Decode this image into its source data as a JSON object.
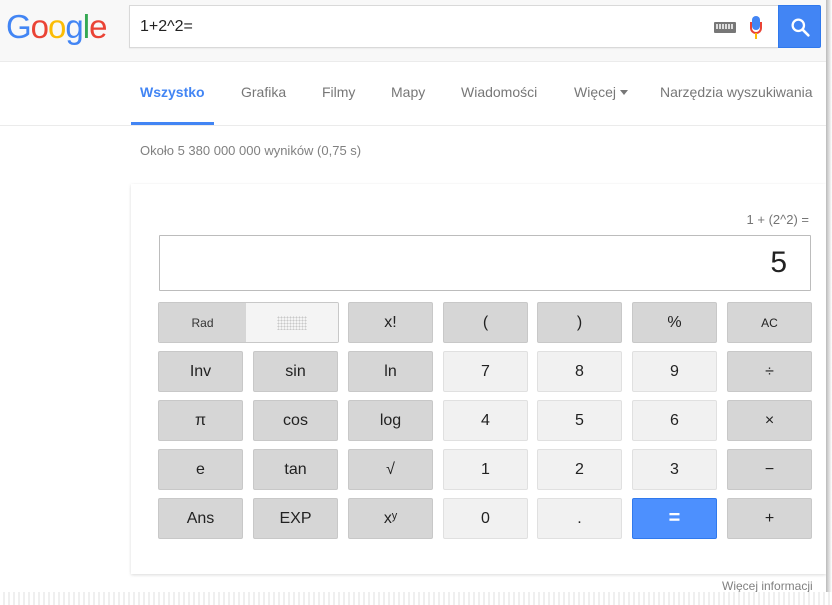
{
  "logo": {
    "text": "Google"
  },
  "search": {
    "query": "1+2^2=",
    "keyboard_icon": "keyboard-icon",
    "mic_icon": "mic-icon",
    "button_icon": "search-icon"
  },
  "tabs": [
    {
      "label": "Wszystko",
      "active": true
    },
    {
      "label": "Grafika"
    },
    {
      "label": "Filmy"
    },
    {
      "label": "Mapy"
    },
    {
      "label": "Wiadomości"
    },
    {
      "label": "Więcej"
    },
    {
      "label": "Narzędzia wyszukiwania"
    }
  ],
  "stats": "Około 5 380 000 000 wyników (0,75 s)",
  "calculator": {
    "expression": "1 + (2^2) =",
    "result": "5",
    "mode": {
      "rad": "Rad"
    },
    "rows": [
      [
        "x!",
        "(",
        ")",
        "%",
        "AC"
      ],
      [
        "Inv",
        "sin",
        "ln",
        "7",
        "8",
        "9",
        "÷"
      ],
      [
        "π",
        "cos",
        "log",
        "4",
        "5",
        "6",
        "×"
      ],
      [
        "e",
        "tan",
        "√",
        "1",
        "2",
        "3",
        "−"
      ],
      [
        "Ans",
        "EXP",
        "xʸ",
        "0",
        ".",
        "=",
        "+"
      ]
    ]
  },
  "footer": {
    "more_info": "Więcej informacji"
  },
  "colors": {
    "accent": "#4285f4",
    "equals": "#4d90fe"
  }
}
